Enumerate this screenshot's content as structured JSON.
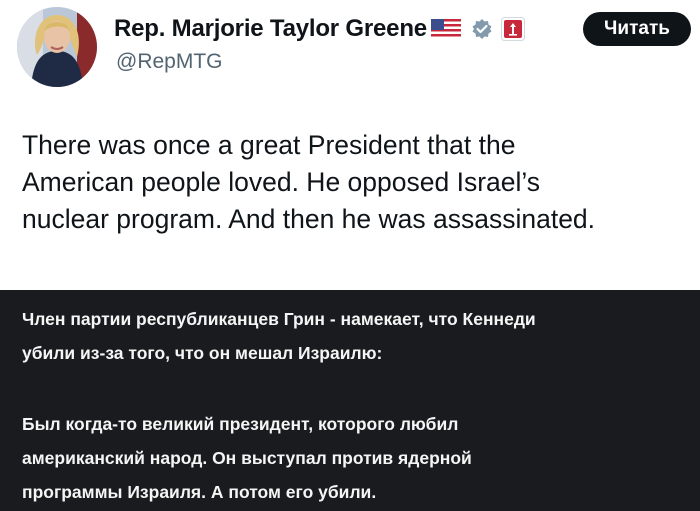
{
  "tweet": {
    "author_name": "Rep. Marjorie Taylor Greene",
    "handle": "@RepMTG",
    "follow_label": "Читать",
    "text": "There was once a great President that the\nAmerican people loved. He opposed Israel’s\nnuclear program. And then he was assassinated.",
    "icons": [
      "us-flag-icon",
      "verified-badge-icon",
      "government-seal-icon"
    ],
    "colors": {
      "verified": "#829aab",
      "follow_bg": "#0f1419",
      "handle": "#536471"
    }
  },
  "caption": {
    "intro": "Член партии республиканцев Грин - намекает, что Кеннеди\nубили из-за того, что он мешал Израилю:",
    "translation": "Был когда-то великий президент, которого любил\nамериканский народ. Он выступал против ядерной\nпрограммы Израиля. А потом его убили.",
    "colors": {
      "background": "#1a1b1e",
      "text": "#f5f5f5"
    }
  }
}
